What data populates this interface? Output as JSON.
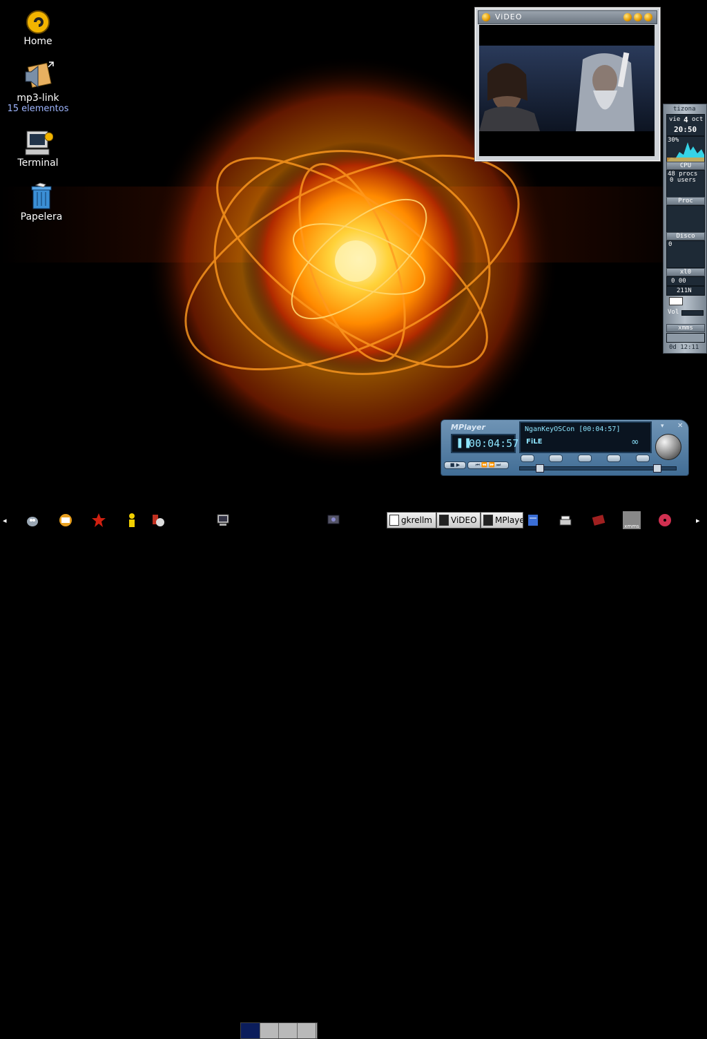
{
  "desktop": {
    "icons": [
      {
        "label": "Home",
        "sub": ""
      },
      {
        "label": "mp3-link",
        "sub": "15 elementos"
      },
      {
        "label": "Terminal",
        "sub": ""
      },
      {
        "label": "Papelera",
        "sub": ""
      }
    ]
  },
  "video_window": {
    "title": "ViDEO"
  },
  "gkrellm": {
    "hostname": "tizona",
    "date_day": "vie",
    "date_num": "4",
    "date_month": "oct",
    "clock": "20:50",
    "cpu_percent": "30%",
    "cpu_label": "CPU",
    "procs": "48 procs",
    "users": "0 users",
    "proc_label": "Proc",
    "disk_zero": "0",
    "disk_label": "Disco",
    "net_label": "xl0",
    "net_value": "0 00",
    "mail_count": "211N",
    "vol_label": "Vol",
    "xmms_label": "xmms",
    "uptime": "0d 12:11"
  },
  "mplayer": {
    "brand": "MPlayer",
    "time": "00:04:57",
    "file_line": "NganKeyOSCon [00:04:57]",
    "file_label": "FiLE",
    "seek_position": 0.1,
    "volume_position": 0.9
  },
  "taskbar": {
    "tasks": [
      {
        "label": "gkrellm"
      },
      {
        "label": "ViDEO"
      },
      {
        "label": "MPlaye"
      }
    ],
    "launchers": [
      "left-arrow-icon",
      "gimp-icon",
      "mail-icon",
      "star-icon",
      "user-icon",
      "tools-icon",
      "monitor-icon",
      "display-icon",
      "script-icon",
      "scanner-icon",
      "book-icon",
      "xmms-icon",
      "cd-icon",
      "right-arrow-icon"
    ],
    "xmms_icon_text": "xmms"
  }
}
